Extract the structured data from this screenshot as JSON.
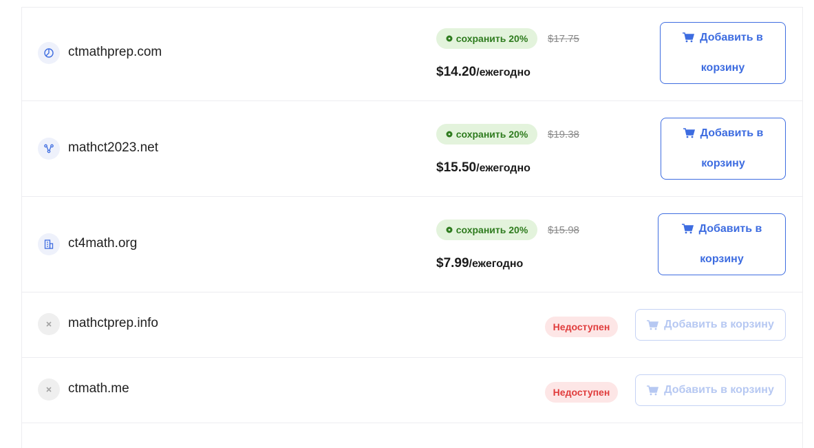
{
  "colors": {
    "accent": "#3d6ce0",
    "save_green": "#2e7b1e",
    "save_bg": "#e3f3dc",
    "unavailable_red": "#e03c3c",
    "unavailable_bg": "#fde6e6"
  },
  "domains": [
    {
      "name": "ctmathprep.com",
      "icon": "pie-chart-icon",
      "available": true,
      "save_label": "сохранить 20%",
      "old_price": "$17.75",
      "price": "$14.20",
      "period": "/ежегодно",
      "cart_line1": "Добавить в",
      "cart_line2": "корзину"
    },
    {
      "name": "mathct2023.net",
      "icon": "network-icon",
      "available": true,
      "save_label": "сохранить 20%",
      "old_price": "$19.38",
      "price": "$15.50",
      "period": "/ежегодно",
      "cart_line1": "Добавить в",
      "cart_line2": "корзину"
    },
    {
      "name": "ct4math.org",
      "icon": "building-icon",
      "available": true,
      "save_label": "сохранить 20%",
      "old_price": "$15.98",
      "price": "$7.99",
      "period": "/ежегодно",
      "cart_line1": "Добавить в",
      "cart_line2": "корзину"
    },
    {
      "name": "mathctprep.info",
      "icon": "close-icon",
      "available": false,
      "status": "Недоступен",
      "cart_label": "Добавить в корзину"
    },
    {
      "name": "ctmath.me",
      "icon": "close-icon",
      "available": false,
      "status": "Недоступен",
      "cart_label": "Добавить в корзину"
    }
  ]
}
